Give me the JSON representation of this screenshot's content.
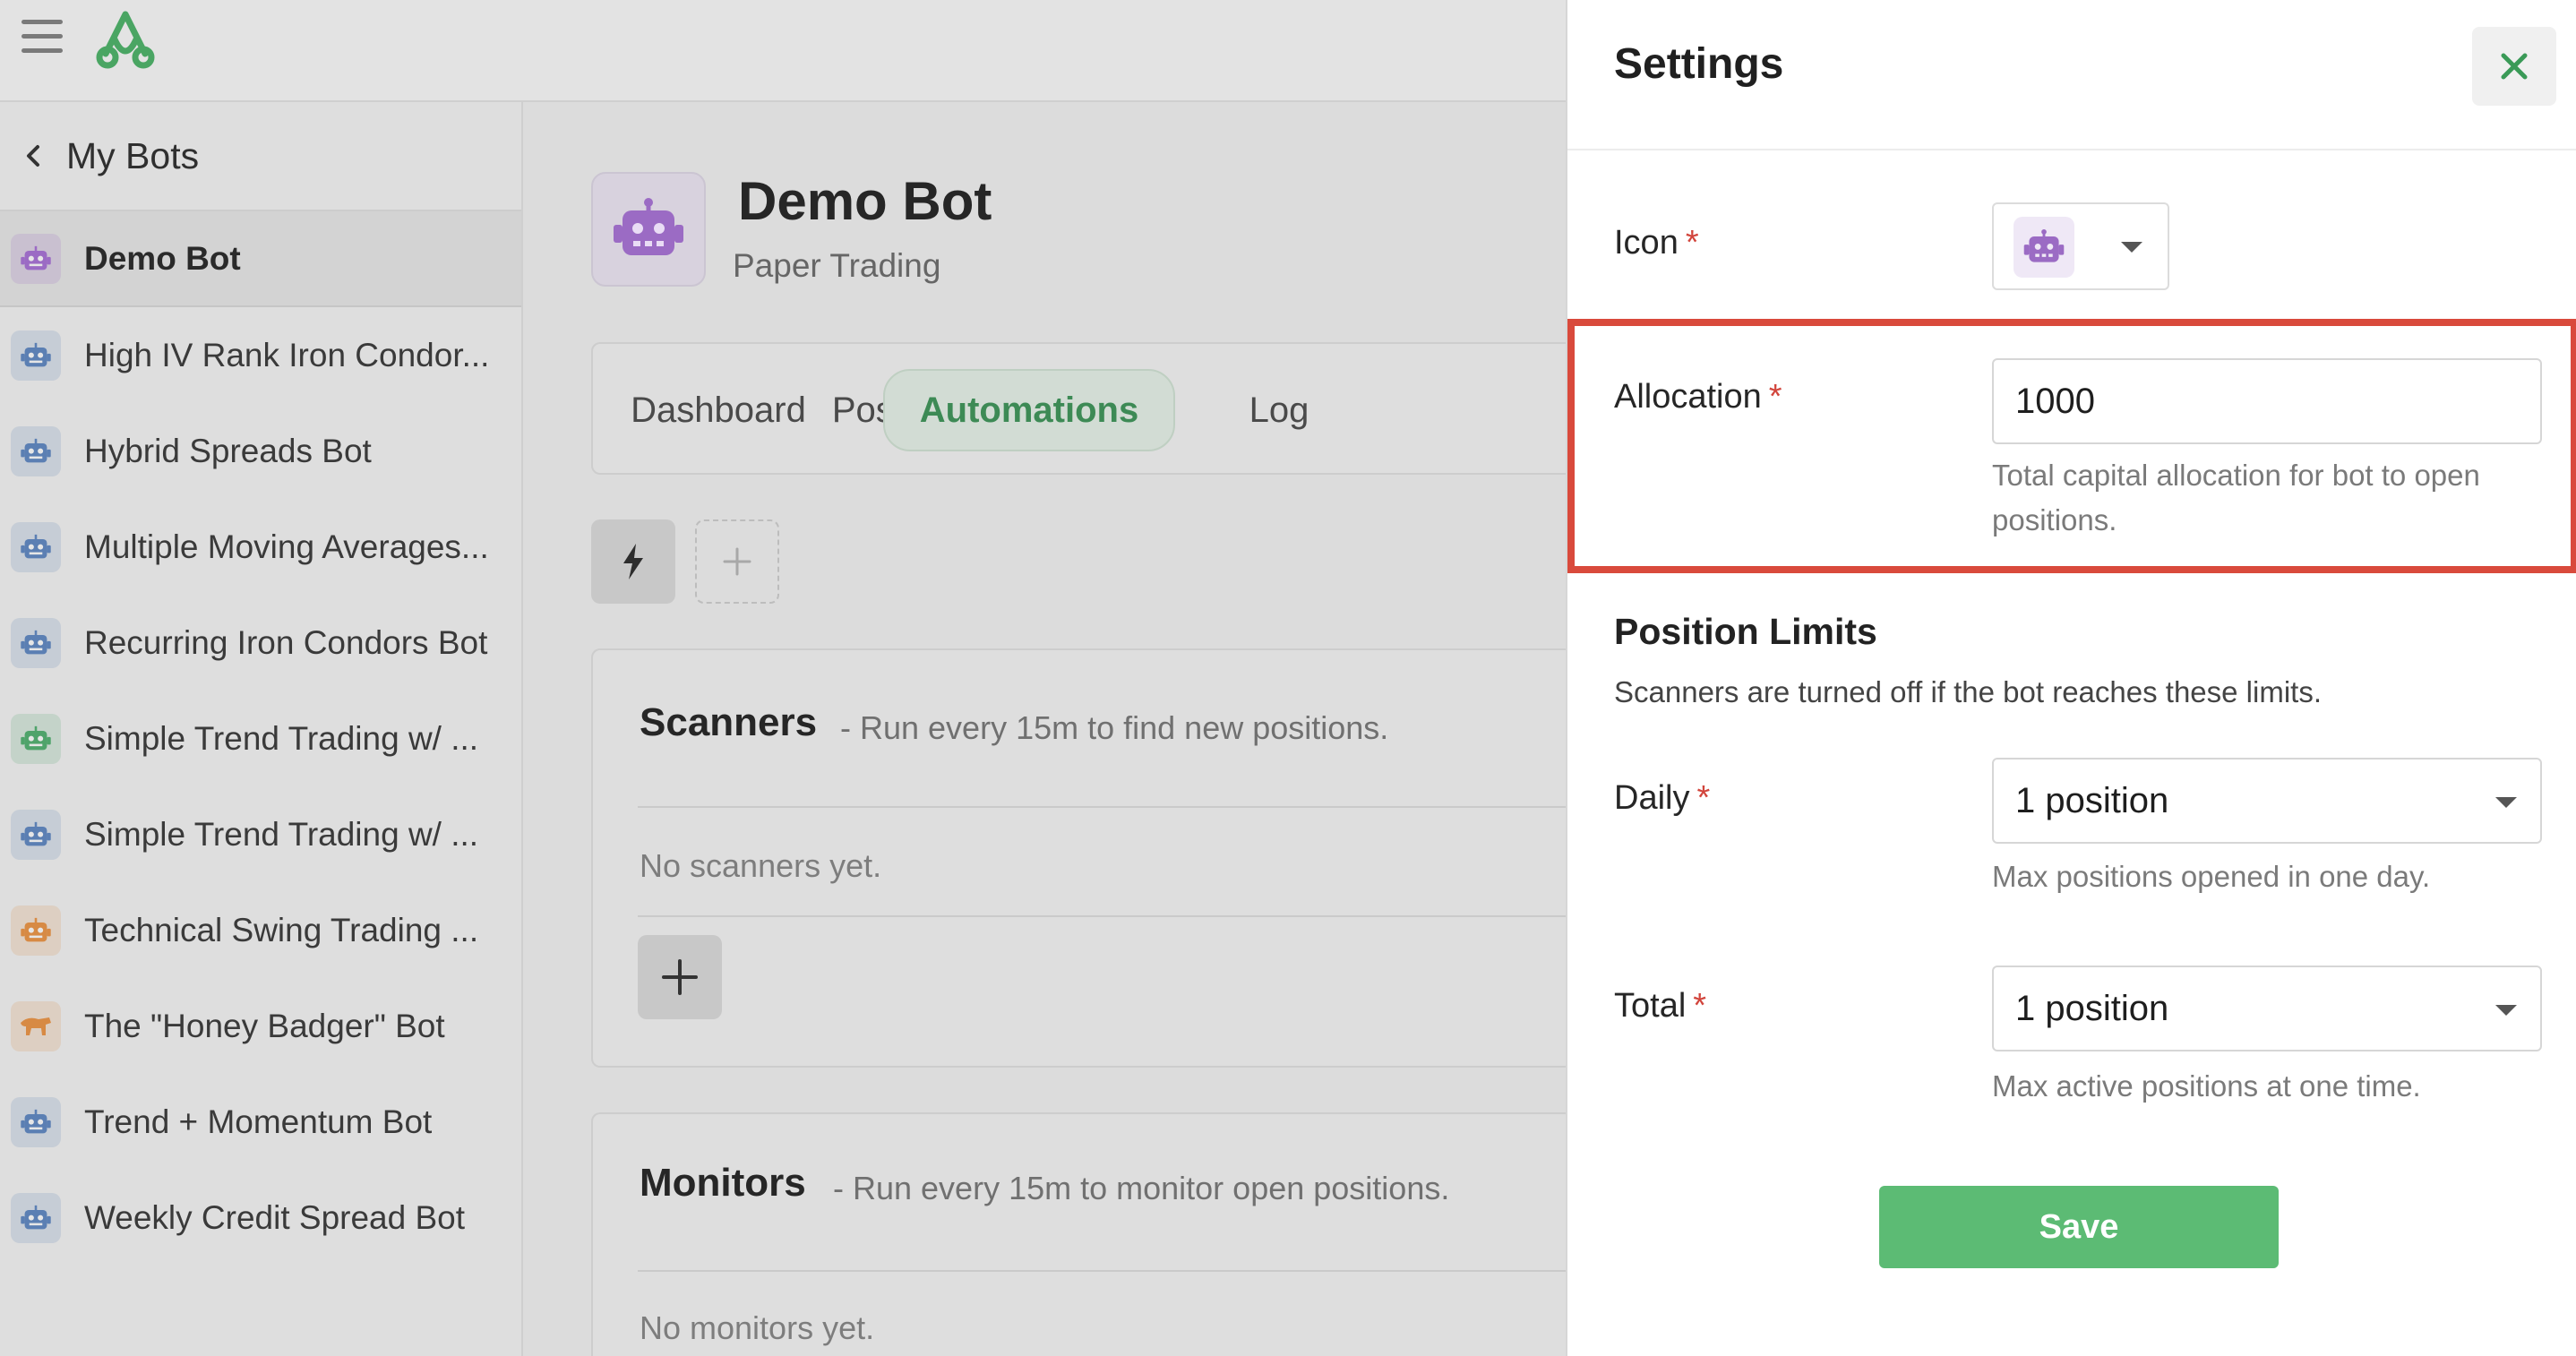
{
  "sidebar": {
    "back_label": "My Bots",
    "items": [
      {
        "label": "Demo Bot",
        "color": "#9b6bc4",
        "icon": "robot-icon",
        "active": true
      },
      {
        "label": "High IV Rank Iron Condor...",
        "color": "#5b7fb3",
        "icon": "robot-icon"
      },
      {
        "label": "Hybrid Spreads Bot",
        "color": "#5b7fb3",
        "icon": "robot-icon"
      },
      {
        "label": "Multiple Moving Averages...",
        "color": "#5b7fb3",
        "icon": "robot-icon"
      },
      {
        "label": "Recurring Iron Condors Bot",
        "color": "#5b7fb3",
        "icon": "robot-icon"
      },
      {
        "label": "Simple Trend Trading w/ ...",
        "color": "#4fa36a",
        "icon": "robot-icon"
      },
      {
        "label": "Simple Trend Trading w/ ...",
        "color": "#5b7fb3",
        "icon": "robot-icon"
      },
      {
        "label": "Technical Swing Trading ...",
        "color": "#d78a44",
        "icon": "robot-icon"
      },
      {
        "label": "The \"Honey Badger\" Bot",
        "color": "#d78a44",
        "icon": "badger-icon"
      },
      {
        "label": "Trend + Momentum Bot",
        "color": "#5b7fb3",
        "icon": "robot-icon"
      },
      {
        "label": "Weekly Credit Spread Bot",
        "color": "#5b7fb3",
        "icon": "robot-icon"
      }
    ]
  },
  "header": {
    "title": "Demo Bot",
    "subtitle": "Paper Trading"
  },
  "tabs": [
    {
      "label": "Dashboard"
    },
    {
      "label": "Positions"
    },
    {
      "label": "Automations",
      "active": true
    },
    {
      "label": "Log"
    }
  ],
  "scanners": {
    "title": "Scanners",
    "description": "- Run every 15m to find new positions.",
    "empty": "No scanners yet."
  },
  "monitors": {
    "title": "Monitors",
    "description": "- Run every 15m to monitor open positions.",
    "empty": "No monitors yet."
  },
  "settings": {
    "title": "Settings",
    "icon_label": "Icon",
    "allocation_label": "Allocation",
    "allocation_value": "1000",
    "allocation_help": "Total capital allocation for bot to open positions.",
    "limits_title": "Position Limits",
    "limits_desc": "Scanners are turned off if the bot reaches these limits.",
    "daily_label": "Daily",
    "daily_value": "1 position",
    "daily_help": "Max positions opened in one day.",
    "total_label": "Total",
    "total_value": "1 position",
    "total_help": "Max active positions at one time.",
    "save_label": "Save",
    "required_mark": "*"
  },
  "colors": {
    "accent_green": "#5cbb74",
    "highlight_red": "#d94a3c",
    "bot_purple": "#9b6bc4"
  }
}
